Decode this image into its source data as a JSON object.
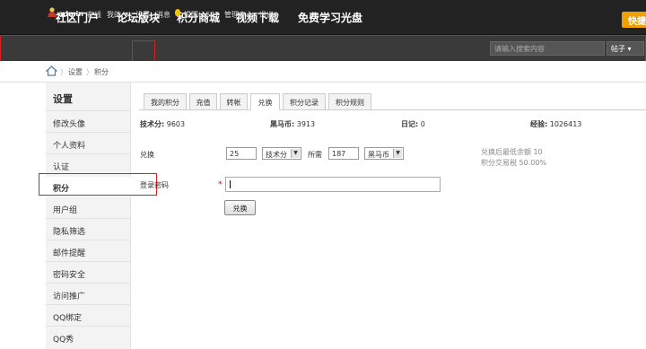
{
  "topnav": {
    "items": [
      "社区门户",
      "论坛版块",
      "积分商城",
      "视频下载",
      "免费学习光盘"
    ],
    "quick_label": "快捷"
  },
  "userbar": {
    "username": "admin",
    "status": "在线",
    "my": "我的",
    "settings": "设置",
    "messages": "消息",
    "reminders": "提醒(158)",
    "admin_center": "管理中心",
    "logout": "退出",
    "search_placeholder": "请输入搜索内容",
    "search_type": "帖子"
  },
  "breadcrumb": {
    "items": [
      "设置",
      "积分"
    ]
  },
  "sidebar": {
    "title": "设置",
    "items": [
      "修改头像",
      "个人资料",
      "认证",
      "积分",
      "用户组",
      "隐私筛选",
      "邮件提醒",
      "密码安全",
      "访问推广",
      "QQ绑定",
      "QQ秀"
    ],
    "active": "积分"
  },
  "tabs": [
    "我的积分",
    "充值",
    "转帐",
    "兑换",
    "积分记录",
    "积分规则"
  ],
  "active_tab": "兑换",
  "stats": [
    {
      "label": "技术分:",
      "value": "9603"
    },
    {
      "label": "黑马币:",
      "value": "3913"
    },
    {
      "label": "日记:",
      "value": "0"
    },
    {
      "label": "经验:",
      "value": "1026413"
    }
  ],
  "exchange": {
    "label": "兑换",
    "amount": "25",
    "from_unit": "技术分",
    "need_label": "所需",
    "need_amount": "187",
    "to_unit": "黑马币",
    "note_min": "兑换后最低余额 10",
    "note_tax": "积分交易税 50.00%"
  },
  "password": {
    "label": "登录密码",
    "required_mark": "*"
  },
  "submit_label": "兑换",
  "colors": {
    "topnav_bg": "#222222",
    "quick_btn": "#f0a000",
    "highlight_box": "#d52020"
  }
}
